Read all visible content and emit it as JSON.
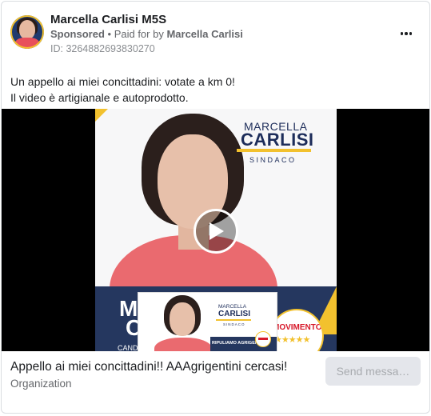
{
  "post": {
    "page_name": "Marcella Carlisi M5S",
    "sponsored_label": "Sponsored",
    "separator": " • ",
    "paid_for_prefix": "Paid for by ",
    "paid_for_name": "Marcella Carlisi",
    "ad_id": "ID: 3264882693830270",
    "body_lines": [
      "Un appello ai miei concittadini: votate a km 0!",
      "Il video è artigianale e autoprodotto."
    ],
    "more_icon": "more-horizontal-icon"
  },
  "video": {
    "play_icon": "play-icon",
    "poster": {
      "first_name": "MARCELLA",
      "last_name": "CARLISI",
      "role": "SINDACO",
      "large_initial_1": "M",
      "large_initial_2": "C",
      "cand_text": "CAND",
      "badge_text": "MOVIMENTO",
      "badge_stars": "★★★★★",
      "inset_first_name": "MARCELLA",
      "inset_last_name": "CARLISI",
      "inset_role": "SINDACO",
      "inset_slogan": "RIPULIAMO AGRIGENTO"
    }
  },
  "footer": {
    "headline": "Appello ai miei concittadini!! AAAgrigentini cercasi!",
    "category": "Organization",
    "cta_label": "Send messa…"
  },
  "colors": {
    "accent_yellow": "#f2c12e",
    "navy": "#1d2d5a",
    "shirt_coral": "#ea6a6f",
    "muted_text": "#65676b",
    "cta_bg": "#e4e6eb"
  }
}
